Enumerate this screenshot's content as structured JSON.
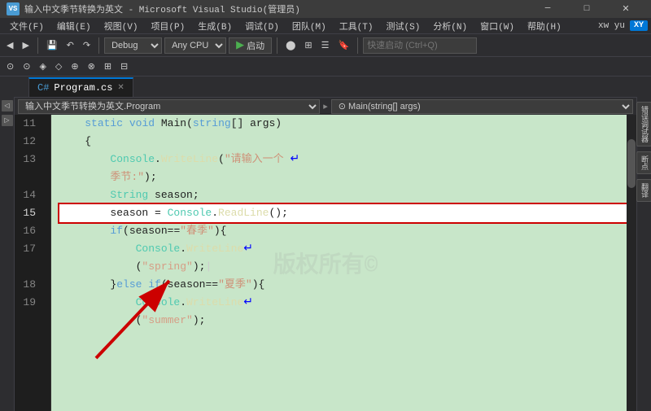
{
  "window": {
    "title": "输入中文季节转换为英文 - Microsoft Visual Studio(管理员)",
    "icon": "VS"
  },
  "menu": {
    "items": [
      "文件(F)",
      "编辑(E)",
      "视图(V)",
      "项目(P)",
      "生成(B)",
      "调试(D)",
      "团队(M)",
      "工具(T)",
      "测试(S)",
      "分析(N)",
      "窗口(W)",
      "帮助(H)"
    ]
  },
  "toolbar": {
    "config": "Debug",
    "platform": "Any CPU",
    "run_label": "启动",
    "search_placeholder": "快速启动 (Ctrl+Q)",
    "user_label": "xw yu",
    "user_badge": "XY"
  },
  "tab": {
    "name": "Program.cs",
    "active": true
  },
  "code_nav": {
    "namespace": "输入中文季节转换为英文.Program",
    "arrow": "▸",
    "method": "Main(string[] args)"
  },
  "code": {
    "lines": [
      {
        "num": 11,
        "content": "    static void Main(string[] args)",
        "highlighted": false
      },
      {
        "num": 12,
        "content": "    {",
        "highlighted": false
      },
      {
        "num": 13,
        "content": "        Console.WriteLine(“请输入一个",
        "highlighted": false
      },
      {
        "num": "13b",
        "content": "        季节:\");",
        "highlighted": false,
        "continuation": true
      },
      {
        "num": 14,
        "content": "        String season;",
        "highlighted": false
      },
      {
        "num": 15,
        "content": "        season = Console.ReadLine();",
        "highlighted": true
      },
      {
        "num": 16,
        "content": "        if(season==\"春季\"){",
        "highlighted": false
      },
      {
        "num": 17,
        "content": "            Console.WriteLine",
        "highlighted": false
      },
      {
        "num": "17b",
        "content": "            (\"spring\");|",
        "highlighted": false,
        "continuation": true
      },
      {
        "num": 18,
        "content": "        }else if(season==\"夏季\"){",
        "highlighted": false
      },
      {
        "num": 19,
        "content": "            Console.WriteLine",
        "highlighted": false
      },
      {
        "num": "19b",
        "content": "            (\"summer\");",
        "highlighted": false,
        "continuation": true
      }
    ]
  },
  "right_panel": {
    "items": [
      "错误调试器",
      "断点",
      "翻译"
    ]
  },
  "watermark": "版权所有©"
}
